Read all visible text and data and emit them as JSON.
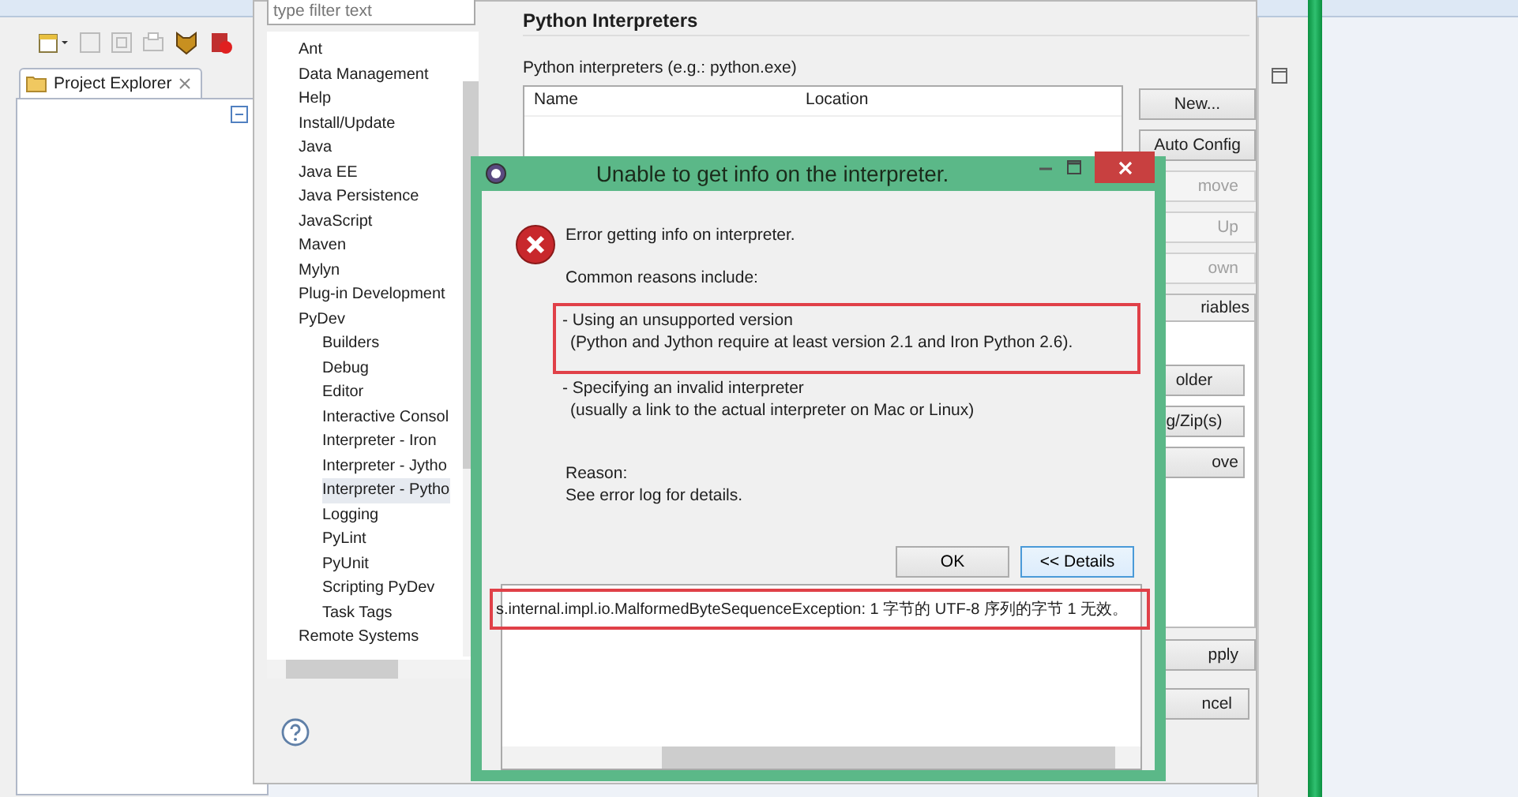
{
  "project_explorer": {
    "tab": "Project Explorer"
  },
  "preferences": {
    "filter": {
      "placeholder": "type filter text"
    },
    "tree": [
      {
        "label": "Ant",
        "selected": false
      },
      {
        "label": "Data Management",
        "selected": false
      },
      {
        "label": "Help",
        "selected": false
      },
      {
        "label": "Install/Update",
        "selected": false
      },
      {
        "label": "Java",
        "selected": false
      },
      {
        "label": "Java EE",
        "selected": false
      },
      {
        "label": "Java Persistence",
        "selected": false
      },
      {
        "label": "JavaScript",
        "selected": false
      },
      {
        "label": "Maven",
        "selected": false
      },
      {
        "label": "Mylyn",
        "selected": false
      },
      {
        "label": "Plug-in Development",
        "selected": false
      },
      {
        "label": "PyDev",
        "selected": false,
        "children": [
          {
            "label": "Builders",
            "selected": false
          },
          {
            "label": "Debug",
            "selected": false
          },
          {
            "label": "Editor",
            "selected": false
          },
          {
            "label": "Interactive Consol",
            "selected": false
          },
          {
            "label": "Interpreter - Iron",
            "selected": false
          },
          {
            "label": "Interpreter - Jytho",
            "selected": false
          },
          {
            "label": "Interpreter - Pytho",
            "selected": true
          },
          {
            "label": "Logging",
            "selected": false
          },
          {
            "label": "PyLint",
            "selected": false
          },
          {
            "label": "PyUnit",
            "selected": false
          },
          {
            "label": "Scripting PyDev",
            "selected": false
          },
          {
            "label": "Task Tags",
            "selected": false
          }
        ]
      },
      {
        "label": "Remote Systems",
        "selected": false
      }
    ],
    "page_title": "Python Interpreters",
    "label": "Python interpreters (e.g.: python.exe)",
    "table": {
      "columns": [
        "Name",
        "Location"
      ]
    },
    "buttons": [
      {
        "label": "New...",
        "disabled": false
      },
      {
        "label": "Auto Config",
        "disabled": false
      },
      {
        "label": "move",
        "disabled": true
      },
      {
        "label": "Up",
        "disabled": true
      },
      {
        "label": "own",
        "disabled": true
      }
    ],
    "variables_tab": "riables",
    "library_buttons": [
      "older",
      "g/Zip(s)",
      "ove"
    ],
    "apply": "pply",
    "cancel": "ncel"
  },
  "error_dialog": {
    "title": "Unable to get info on the interpreter.",
    "message": "Error getting info on interpreter.",
    "intro": "Common reasons include:",
    "reasons": [
      {
        "lines": [
          "- Using an unsupported version",
          "(Python and Jython require at least version 2.1 and Iron Python 2.6)."
        ],
        "highlighted": true
      },
      {
        "lines": [
          "- Specifying an invalid interpreter",
          "(usually a link to the actual interpreter on Mac or Linux)"
        ],
        "highlighted": false
      }
    ],
    "reason_label": "Reason:",
    "reason_text": "See error log for details.",
    "buttons": [
      {
        "label": "OK",
        "selected": false
      },
      {
        "label": "<< Details",
        "selected": true
      }
    ],
    "details": {
      "text": "s.internal.impl.io.MalformedByteSequenceException: 1 字节的 UTF-8 序列的字节 1 无效。",
      "highlighted": true
    }
  }
}
